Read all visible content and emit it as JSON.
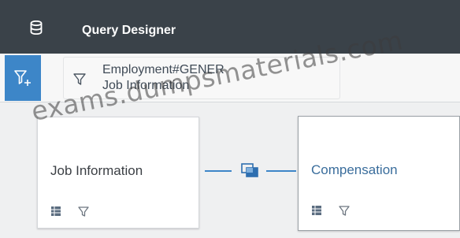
{
  "header": {
    "title": "Query Designer",
    "icon": "database-icon",
    "background": "#3a4249"
  },
  "filter_bar": {
    "add_filter_icon": "add-filter-icon",
    "accent": "#3d86c8",
    "token": {
      "icon": "filter-icon",
      "line1": "Employment#GENER",
      "line2": "Job Information"
    }
  },
  "canvas": {
    "cards": [
      {
        "title": "Job Information",
        "icons": [
          "table-icon",
          "filter-icon"
        ]
      },
      {
        "title": "Compensation",
        "icons": [
          "table-icon",
          "filter-icon"
        ]
      }
    ],
    "join_icon": "join-icon"
  },
  "watermark": "exams.dumpsmaterials.com"
}
